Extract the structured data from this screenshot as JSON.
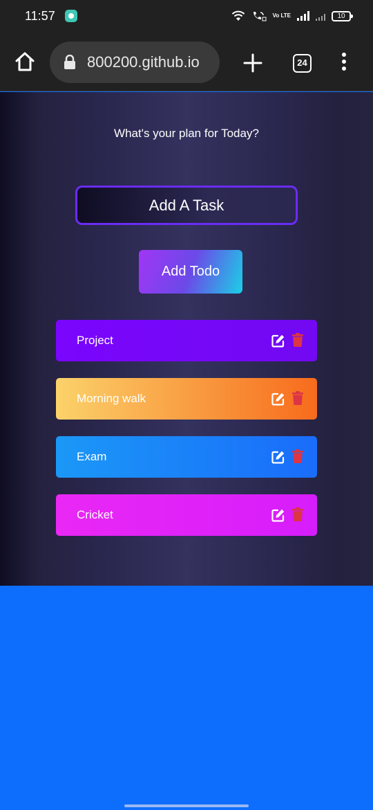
{
  "status_bar": {
    "time": "11:57",
    "volte": "Vo LTE",
    "battery": "10"
  },
  "browser": {
    "url": "800200.github.io",
    "tab_count": "24"
  },
  "app": {
    "title": "What's your plan for Today?",
    "input_placeholder": "Add A Task",
    "add_button_label": "Add Todo",
    "todos": [
      {
        "text": "Project",
        "gradient": [
          "#7a06fd",
          "#7209f2"
        ],
        "text_color": "#ffffff"
      },
      {
        "text": "Morning walk",
        "gradient": [
          "#fbd26a",
          "#f76b1c"
        ],
        "text_color": "#ffffff"
      },
      {
        "text": "Exam",
        "gradient": [
          "#1b98f7",
          "#1a6cfa"
        ],
        "text_color": "#ffffff"
      },
      {
        "text": "Cricket",
        "gradient": [
          "#ea28f5",
          "#d61dfb"
        ],
        "text_color": "#ffffff"
      }
    ],
    "delete_color": "#dc3545"
  }
}
